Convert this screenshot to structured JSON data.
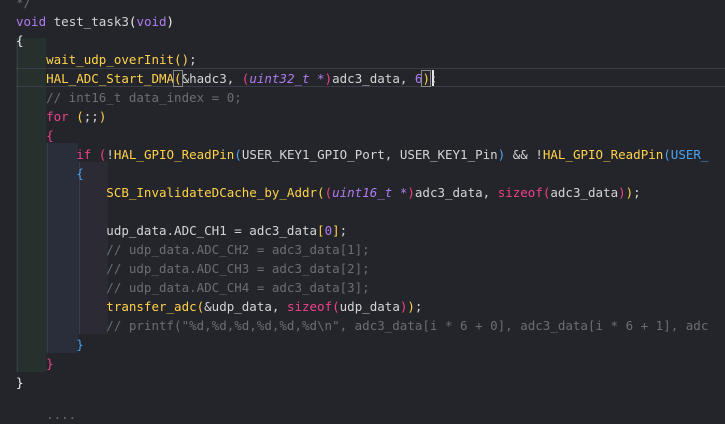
{
  "editor": {
    "lines": [
      {
        "id": "l0",
        "tokens": [
          {
            "t": "*/",
            "c": "cm"
          }
        ]
      },
      {
        "id": "l1",
        "tokens": [
          {
            "t": "void ",
            "c": "kw2"
          },
          {
            "t": "test_task3",
            "c": ""
          },
          {
            "t": "(",
            "c": "br1"
          },
          {
            "t": "void",
            "c": "kw2"
          },
          {
            "t": ")",
            "c": "br1"
          }
        ]
      },
      {
        "id": "l2",
        "tokens": [
          {
            "t": "{",
            "c": "br1"
          }
        ]
      },
      {
        "id": "l3",
        "tokens": [
          {
            "t": "    wait_udp_overInit",
            "c": "fn"
          },
          {
            "t": "()",
            "c": "br2"
          },
          {
            "t": ";",
            "c": ""
          }
        ]
      },
      {
        "id": "l4",
        "tokens": [
          {
            "t": "    HAL_ADC_Start_DMA",
            "c": "fn"
          },
          {
            "t": "(",
            "c": "br2m"
          },
          {
            "t": "&hadc3, ",
            "c": ""
          },
          {
            "t": "(",
            "c": "br3"
          },
          {
            "t": "uint32_t *",
            "c": "ty"
          },
          {
            "t": ")",
            "c": "br3"
          },
          {
            "t": "adc3_data, ",
            "c": ""
          },
          {
            "t": "6",
            "c": "num"
          },
          {
            "t": ")",
            "c": "br2m"
          },
          {
            "t": ";",
            "c": ""
          }
        ]
      },
      {
        "id": "l5",
        "tokens": [
          {
            "t": "    // int16_t data_index = 0;",
            "c": "cm"
          }
        ]
      },
      {
        "id": "l6",
        "tokens": [
          {
            "t": "    for ",
            "c": "kw"
          },
          {
            "t": "(",
            "c": "br2"
          },
          {
            "t": ";;",
            "c": ""
          },
          {
            "t": ")",
            "c": "br2"
          }
        ]
      },
      {
        "id": "l7",
        "tokens": [
          {
            "t": "    {",
            "c": "br3"
          }
        ]
      },
      {
        "id": "l8",
        "tokens": [
          {
            "t": "        if ",
            "c": "kw"
          },
          {
            "t": "(",
            "c": "br3"
          },
          {
            "t": "!",
            "c": ""
          },
          {
            "t": "HAL_GPIO_ReadPin",
            "c": "fn"
          },
          {
            "t": "(",
            "c": "br4"
          },
          {
            "t": "USER_KEY1_GPIO_Port, USER_KEY1_Pin",
            "c": ""
          },
          {
            "t": ")",
            "c": "br4"
          },
          {
            "t": " && !",
            "c": ""
          },
          {
            "t": "HAL_GPIO_ReadPin",
            "c": "fn"
          },
          {
            "t": "(USER_",
            "c": "br4"
          }
        ]
      },
      {
        "id": "l9",
        "tokens": [
          {
            "t": "        {",
            "c": "br4"
          }
        ]
      },
      {
        "id": "l10",
        "tokens": [
          {
            "t": "            SCB_InvalidateDCache_by_Addr",
            "c": "fn"
          },
          {
            "t": "(",
            "c": "br2"
          },
          {
            "t": "(",
            "c": "br3"
          },
          {
            "t": "uint16_t *",
            "c": "ty"
          },
          {
            "t": ")",
            "c": "br3"
          },
          {
            "t": "adc3_data, ",
            "c": ""
          },
          {
            "t": "sizeof",
            "c": "kw"
          },
          {
            "t": "(",
            "c": "br3"
          },
          {
            "t": "adc3_data",
            "c": ""
          },
          {
            "t": ")",
            "c": "br3"
          },
          {
            "t": ")",
            "c": "br2"
          },
          {
            "t": ";",
            "c": ""
          }
        ]
      },
      {
        "id": "l11",
        "tokens": []
      },
      {
        "id": "l12",
        "tokens": [
          {
            "t": "            udp_data.ADC_CH1 = adc3_data",
            "c": ""
          },
          {
            "t": "[",
            "c": "br2"
          },
          {
            "t": "0",
            "c": "num"
          },
          {
            "t": "]",
            "c": "br2"
          },
          {
            "t": ";",
            "c": ""
          }
        ]
      },
      {
        "id": "l13",
        "tokens": [
          {
            "t": "            // udp_data.ADC_CH2 = adc3_data[1];",
            "c": "cm"
          }
        ]
      },
      {
        "id": "l14",
        "tokens": [
          {
            "t": "            // udp_data.ADC_CH3 = adc3_data[2];",
            "c": "cm"
          }
        ]
      },
      {
        "id": "l15",
        "tokens": [
          {
            "t": "            // udp_data.ADC_CH4 = adc3_data[3];",
            "c": "cm"
          }
        ]
      },
      {
        "id": "l16",
        "tokens": [
          {
            "t": "            transfer_adc",
            "c": "fn"
          },
          {
            "t": "(",
            "c": "br2"
          },
          {
            "t": "&udp_data, ",
            "c": ""
          },
          {
            "t": "sizeof",
            "c": "kw"
          },
          {
            "t": "(",
            "c": "br3"
          },
          {
            "t": "udp_data",
            "c": ""
          },
          {
            "t": ")",
            "c": "br3"
          },
          {
            "t": ")",
            "c": "br2"
          },
          {
            "t": ";",
            "c": ""
          }
        ]
      },
      {
        "id": "l17",
        "tokens": [
          {
            "t": "            // printf(\"%d,%d,%d,%d,%d,%d\\n\", adc3_data[i * 6 + 0], adc3_data[i * 6 + 1], adc",
            "c": "cm"
          }
        ]
      },
      {
        "id": "l18",
        "tokens": [
          {
            "t": "        }",
            "c": "br4"
          }
        ]
      },
      {
        "id": "l19",
        "tokens": [
          {
            "t": "    }",
            "c": "br3"
          }
        ]
      },
      {
        "id": "l20",
        "tokens": [
          {
            "t": "}",
            "c": "br1"
          }
        ]
      },
      {
        "id": "l21",
        "tokens": [
          {
            "t": "    ....",
            "c": "cm"
          }
        ]
      }
    ],
    "colors": {
      "background": "#23252b",
      "function": "#ffd24a",
      "keyword": "#f0408a",
      "type": "#b07cf0",
      "comment": "#6a6d75",
      "text": "#d4d4d4"
    }
  }
}
